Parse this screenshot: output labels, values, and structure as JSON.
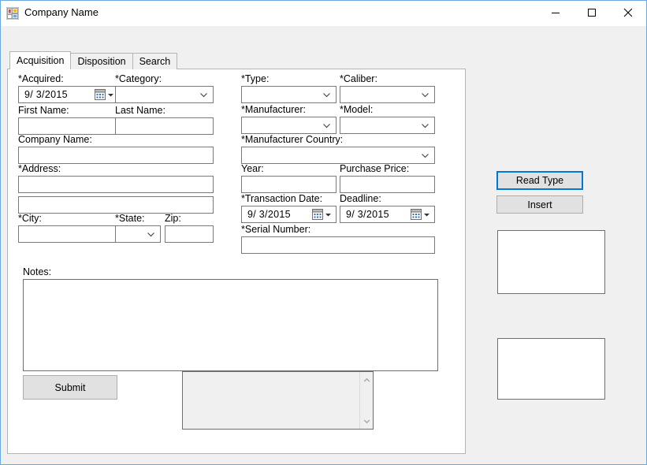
{
  "window": {
    "title": "Company Name",
    "icon": "winforms-app-icon",
    "controls": {
      "minimize": "minimize-icon",
      "maximize": "maximize-icon",
      "close": "close-icon"
    }
  },
  "tabs": [
    {
      "label": "Acquisition",
      "selected": true
    },
    {
      "label": "Disposition",
      "selected": false
    },
    {
      "label": "Search",
      "selected": false
    }
  ],
  "form": {
    "left_column": {
      "acquired": {
        "label": "*Acquired:",
        "value": "9/  3/2015"
      },
      "first_name": {
        "label": "First Name:",
        "value": ""
      },
      "company_name": {
        "label": "Company Name:",
        "value": ""
      },
      "address": {
        "label": "*Address:",
        "value": "",
        "value2": ""
      },
      "city": {
        "label": "*City:",
        "value": ""
      }
    },
    "left_right_column": {
      "category": {
        "label": "*Category:",
        "value": ""
      },
      "last_name": {
        "label": "Last Name:",
        "value": ""
      },
      "state": {
        "label": "*State:",
        "value": ""
      },
      "zip": {
        "label": "Zip:",
        "value": ""
      }
    },
    "middle_column": {
      "type": {
        "label": "*Type:",
        "value": ""
      },
      "caliber": {
        "label": "*Caliber:",
        "value": ""
      },
      "manufacturer": {
        "label": "*Manufacturer:",
        "value": ""
      },
      "model": {
        "label": "*Model:",
        "value": ""
      },
      "manufacturer_country": {
        "label": "*Manufacturer Country:",
        "value": ""
      },
      "year": {
        "label": "Year:",
        "value": ""
      },
      "purchase_price": {
        "label": "Purchase Price:",
        "value": ""
      },
      "transaction_date": {
        "label": "*Transaction Date:",
        "value": "9/  3/2015"
      },
      "deadline": {
        "label": "Deadline:",
        "value": "9/  3/2015"
      },
      "serial_number": {
        "label": "*Serial Number:",
        "value": ""
      }
    },
    "notes": {
      "label": "Notes:",
      "value": ""
    },
    "submit_button": "Submit",
    "output_textbox": {
      "value": ""
    }
  },
  "side_panel": {
    "read_type_button": "Read Type",
    "insert_button": "Insert",
    "listbox_top": {
      "items": []
    },
    "listbox_bottom": {
      "items": []
    }
  },
  "colors": {
    "window_border": "#6fa8dc",
    "window_background": "#f0f0f0",
    "panel_background": "#ffffff",
    "focus_accent": "#0078d7",
    "button_face": "#e1e1e1",
    "control_border": "#7a7a7a"
  }
}
